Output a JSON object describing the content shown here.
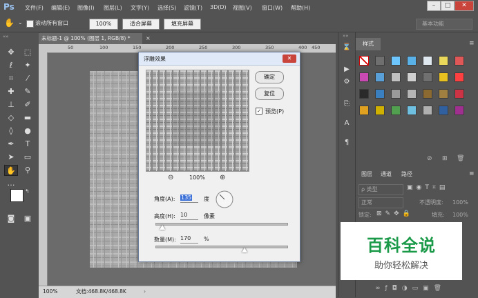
{
  "app": {
    "logo": "Ps"
  },
  "menu": [
    "文件(F)",
    "编辑(E)",
    "图像(I)",
    "图层(L)",
    "文字(Y)",
    "选择(S)",
    "滤镜(T)",
    "3D(D)",
    "视图(V)",
    "窗口(W)",
    "帮助(H)"
  ],
  "options": {
    "scroll_all": "滚动所有窗口",
    "zoom_100": "100%",
    "fit_screen": "适合屏幕",
    "fill_screen": "填充屏幕",
    "workspace": "基本功能"
  },
  "document": {
    "tab_title": "未标题-1 @ 100% (图层 1, RGB/8) *",
    "ruler_marks": [
      "50",
      "100",
      "150",
      "200",
      "250",
      "300",
      "350",
      "400",
      "450"
    ],
    "zoom": "100%",
    "doc_info": "文档:468.8K/468.8K"
  },
  "dialog": {
    "title": "浮雕效果",
    "ok": "确定",
    "reset": "复位",
    "preview_label": "预览(P)",
    "preview_zoom": "100%",
    "angle_label": "角度(A):",
    "angle_value": "135",
    "angle_unit": "度",
    "height_label": "高度(H):",
    "height_value": "10",
    "height_unit": "像素",
    "amount_label": "数量(M):",
    "amount_value": "170",
    "amount_unit": "%",
    "height_slider_fraction": 0.05,
    "amount_slider_fraction": 0.68
  },
  "panels": {
    "styles_tab": "样式",
    "layers_tabs": [
      "图层",
      "通道",
      "路径"
    ],
    "kind_filter": "ρ 类型",
    "blend_mode": "正常",
    "opacity_label": "不透明度:",
    "opacity_value": "100%",
    "lock_label": "锁定:",
    "fill_label": "填充:",
    "fill_value": "100%"
  },
  "watermark": {
    "main": "百科全说",
    "sub": "助你轻松解决"
  }
}
